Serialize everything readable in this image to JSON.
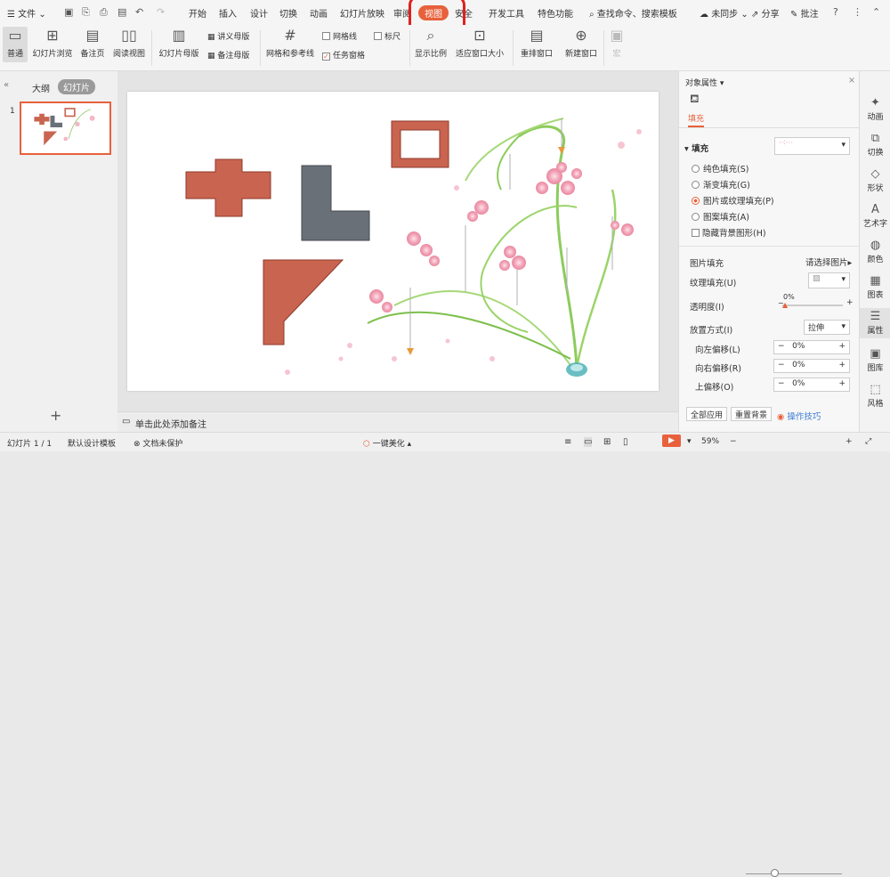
{
  "menu": {
    "file": "文件",
    "items": [
      "开始",
      "插入",
      "设计",
      "切换",
      "动画",
      "幻灯片放映",
      "审阅",
      "视图",
      "安全",
      "开发工具",
      "特色功能"
    ],
    "active": "视图",
    "search": "查找命令、搜索模板",
    "sync": "未同步",
    "share": "分享",
    "comment": "批注"
  },
  "ribbon": {
    "normal": "普通",
    "slide_browse": "幻灯片浏览",
    "notes_page": "备注页",
    "reading": "阅读视图",
    "slide_master": "幻灯片母版",
    "handout_master": "讲义母版",
    "notes_master": "备注母版",
    "grid_guides": "网格和参考线",
    "gridlines": "网格线",
    "ruler": "标尺",
    "task_pane": "任务窗格",
    "zoom": "显示比例",
    "fit_window": "适应窗口大小",
    "arrange": "重排窗口",
    "new_window": "新建窗口",
    "macro": "宏"
  },
  "left": {
    "tab_outline": "大纲",
    "tab_slides": "幻灯片",
    "slide_no": "1"
  },
  "notes": {
    "placeholder": "单击此处添加备注"
  },
  "props": {
    "title": "对象属性",
    "tab": "填充",
    "section": "填充",
    "options": [
      "纯色填充(S)",
      "渐变填充(G)",
      "图片或纹理填充(P)",
      "图案填充(A)"
    ],
    "hide_bg": "隐藏背景图形(H)",
    "pic_fill": "图片填充",
    "pic_choose": "请选择图片",
    "tex_fill": "纹理填充(U)",
    "transparency": "透明度(I)",
    "trans_val": "0%",
    "placement": "放置方式(I)",
    "placement_val": "拉伸",
    "off_left": "向左偏移(L)",
    "off_left_val": "0%",
    "off_right": "向右偏移(R)",
    "off_right_val": "0%",
    "off_top": "上偏移(O)",
    "off_top_val": "0%",
    "apply_all": "全部应用",
    "reset_bg": "重置背景",
    "tips": "操作技巧"
  },
  "rbar": [
    "动画",
    "切换",
    "形状",
    "艺术字",
    "颜色",
    "图表",
    "属性",
    "图库",
    "风格"
  ],
  "status": {
    "slide": "幻灯片 1 / 1",
    "template": "默认设计模板",
    "protect": "文档未保护",
    "beautify": "一键美化",
    "zoom": "59%"
  },
  "colors": {
    "accent": "#e8613c",
    "shape_red": "#c96450",
    "shape_gray": "#6a7078"
  }
}
